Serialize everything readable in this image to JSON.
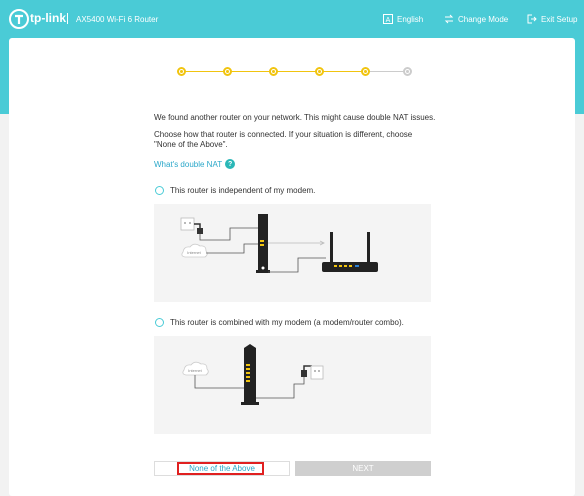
{
  "header": {
    "brand": "tp-link",
    "model": "AX5400 Wi-Fi 6 Router",
    "nav": {
      "language": "English",
      "change_mode": "Change Mode",
      "exit_setup": "Exit Setup"
    }
  },
  "stepper": {
    "total": 6,
    "completed": 5
  },
  "content": {
    "message": "We found another router on your network. This might cause double NAT issues.",
    "instruction": "Choose how that router is connected. If your situation is different, choose \"None of the Above\".",
    "help_link": "What's double NAT",
    "help_icon": "?"
  },
  "options": [
    {
      "label": "This router is independent of my modem.",
      "diagram_label": "Internet",
      "selected": false
    },
    {
      "label": "This router is combined with my modem (a modem/router combo).",
      "diagram_label": "Internet",
      "selected": false
    }
  ],
  "buttons": {
    "none_of_the_above": "None of the Above",
    "next": "NEXT"
  },
  "colors": {
    "brand": "#4acbd6",
    "step_active": "#f1c40f",
    "link": "#2aa7c9",
    "highlight": "#e02020",
    "disabled_button": "#cfcfcf"
  }
}
